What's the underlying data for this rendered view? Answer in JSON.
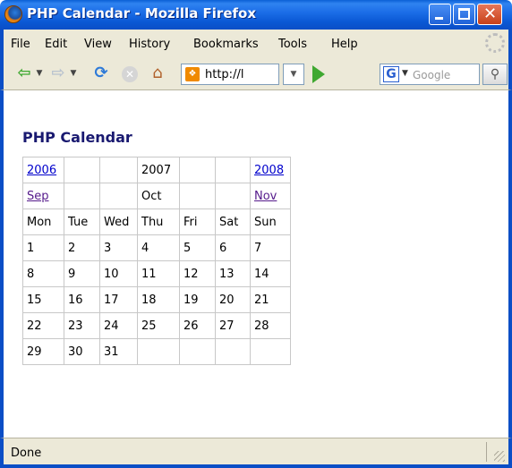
{
  "window": {
    "title": "PHP Calendar - Mozilla Firefox",
    "controls": {
      "close_glyph": "✕"
    }
  },
  "menu": {
    "items": [
      "File",
      "Edit",
      "View",
      "History",
      "Bookmarks",
      "Tools",
      "Help"
    ]
  },
  "toolbar": {
    "url": "http://l",
    "search_placeholder": "Google",
    "search_engine_glyph": "G"
  },
  "page": {
    "title": "PHP Calendar",
    "nav_row_1": [
      "2006",
      "",
      "",
      "2007",
      "",
      "",
      "2008"
    ],
    "nav_row_2": [
      "Sep",
      "",
      "",
      "Oct",
      "",
      "",
      "Nov"
    ],
    "weekdays": [
      "Mon",
      "Tue",
      "Wed",
      "Thu",
      "Fri",
      "Sat",
      "Sun"
    ],
    "weeks": [
      [
        "1",
        "2",
        "3",
        "4",
        "5",
        "6",
        "7"
      ],
      [
        "8",
        "9",
        "10",
        "11",
        "12",
        "13",
        "14"
      ],
      [
        "15",
        "16",
        "17",
        "18",
        "19",
        "20",
        "21"
      ],
      [
        "22",
        "23",
        "24",
        "25",
        "26",
        "27",
        "28"
      ],
      [
        "29",
        "30",
        "31",
        "",
        "",
        "",
        ""
      ]
    ]
  },
  "status": {
    "text": "Done"
  },
  "colors": {
    "titlebar": "#0b4ec6",
    "chrome": "#ece9d8",
    "heading": "#191970",
    "link": "#0000cc",
    "visited_link": "#551a8b"
  }
}
